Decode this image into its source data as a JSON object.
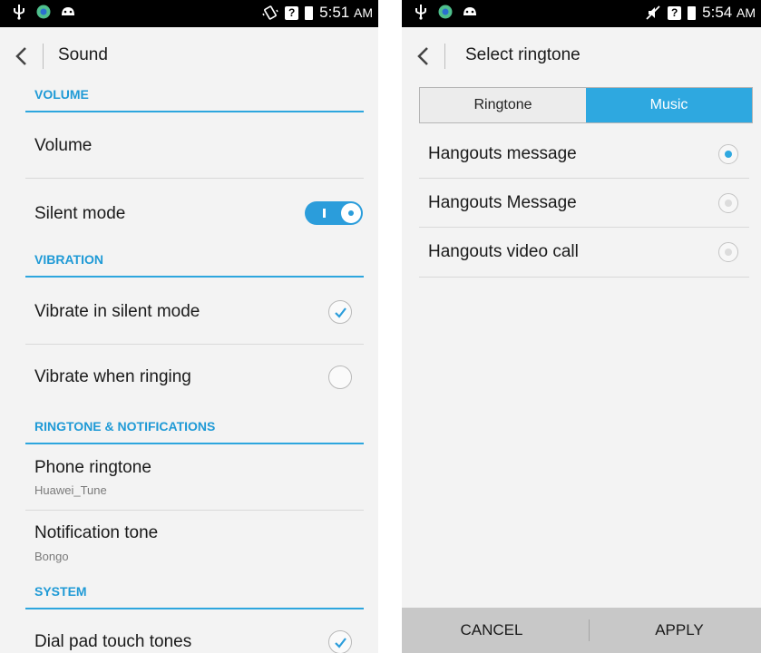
{
  "left": {
    "status": {
      "time": "5:51",
      "ampm": "AM"
    },
    "appbar": {
      "title": "Sound"
    },
    "sections": {
      "volume": "VOLUME",
      "vibration": "VIBRATION",
      "ringtone": "RINGTONE & NOTIFICATIONS",
      "system": "SYSTEM"
    },
    "items": {
      "volume": "Volume",
      "silent_mode": "Silent mode",
      "vibrate_silent": "Vibrate in silent mode",
      "vibrate_ringing": "Vibrate when ringing",
      "phone_ringtone": "Phone ringtone",
      "phone_ringtone_value": "Huawei_Tune",
      "notification_tone": "Notification tone",
      "notification_tone_value": "Bongo",
      "dial_pad": "Dial pad touch tones"
    },
    "states": {
      "silent_mode_on": true,
      "vibrate_silent_checked": true,
      "vibrate_ringing_checked": false,
      "dial_pad_checked": true
    }
  },
  "right": {
    "status": {
      "time": "5:54",
      "ampm": "AM"
    },
    "appbar": {
      "title": "Select ringtone"
    },
    "tabs": [
      {
        "label": "Ringtone",
        "selected": false
      },
      {
        "label": "Music",
        "selected": true
      }
    ],
    "options": [
      {
        "label": "Hangouts message",
        "selected": true
      },
      {
        "label": "Hangouts Message",
        "selected": false
      },
      {
        "label": "Hangouts video call",
        "selected": false
      }
    ],
    "buttons": {
      "cancel": "CANCEL",
      "apply": "APPLY"
    }
  },
  "colors": {
    "accent": "#2ea8e0",
    "section_text": "#1f9ad6",
    "statusbar": "#000000",
    "bottombar": "#c8c8c8"
  },
  "icons": [
    "usb-icon",
    "app-icon",
    "android-icon",
    "vibrate-icon",
    "mute-icon",
    "sim-icon",
    "battery-icon",
    "back-chevron-icon",
    "check-icon"
  ]
}
